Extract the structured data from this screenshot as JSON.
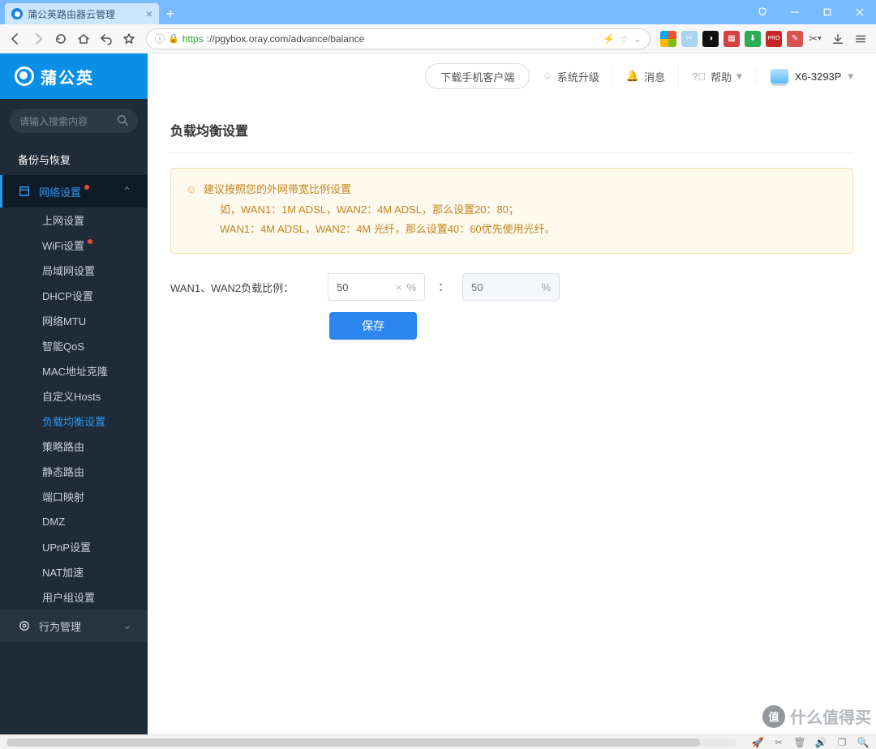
{
  "browser": {
    "tab_title": "蒲公英路由器云管理",
    "url_proto": "https",
    "url_rest": "://pgybox.oray.com/advance/balance",
    "extensions": [
      {
        "name": "microsoft",
        "bg": "linear-gradient(45deg,#f35325 0 50%,#81bc06 0) top/100% 50% no-repeat,linear-gradient(45deg,#05a6f0 0 50%,#ffba08 0) bottom/100% 50% no-repeat"
      },
      {
        "name": "screenshot",
        "bg": "#a7d3f4"
      },
      {
        "name": "video-dl",
        "bg": "#111"
      },
      {
        "name": "adblock",
        "bg": "#d33"
      },
      {
        "name": "download-mgr",
        "bg": "#2c8"
      },
      {
        "name": "pro",
        "bg": "#c62828"
      },
      {
        "name": "note",
        "bg": "#d9534f"
      }
    ]
  },
  "header": {
    "download_btn": "下载手机客户端",
    "upgrade": "系统升级",
    "messages": "消息",
    "help": "帮助",
    "device_name": "X6-3293P"
  },
  "brand_name": "蒲公英",
  "search_placeholder": "请输入搜索内容",
  "sidebar": {
    "backup": "备份与恢复",
    "network_group": "网络设置",
    "subs": [
      "上网设置",
      "WiFi设置",
      "局域网设置",
      "DHCP设置",
      "网络MTU",
      "智能QoS",
      "MAC地址克隆",
      "自定义Hosts",
      "负载均衡设置",
      "策略路由",
      "静态路由",
      "端口映射",
      "DMZ",
      "UPnP设置",
      "NAT加速",
      "用户组设置"
    ],
    "behavior_group": "行为管理"
  },
  "page": {
    "title": "负载均衡设置",
    "tip_l1": "建议按照您的外网带宽比例设置",
    "tip_l2": "如，WAN1：1M ADSL，WAN2：4M ADSL，那么设置20：80；",
    "tip_l3": "WAN1：4M ADSL，WAN2：4M 光纤，那么设置40：60优先使用光纤。",
    "form_label": "WAN1、WAN2负载比例：",
    "wan1_value": "50",
    "wan2_placeholder": "50",
    "percent": "%",
    "save": "保存"
  },
  "watermark": {
    "badge": "值",
    "text": "什么值得买"
  }
}
